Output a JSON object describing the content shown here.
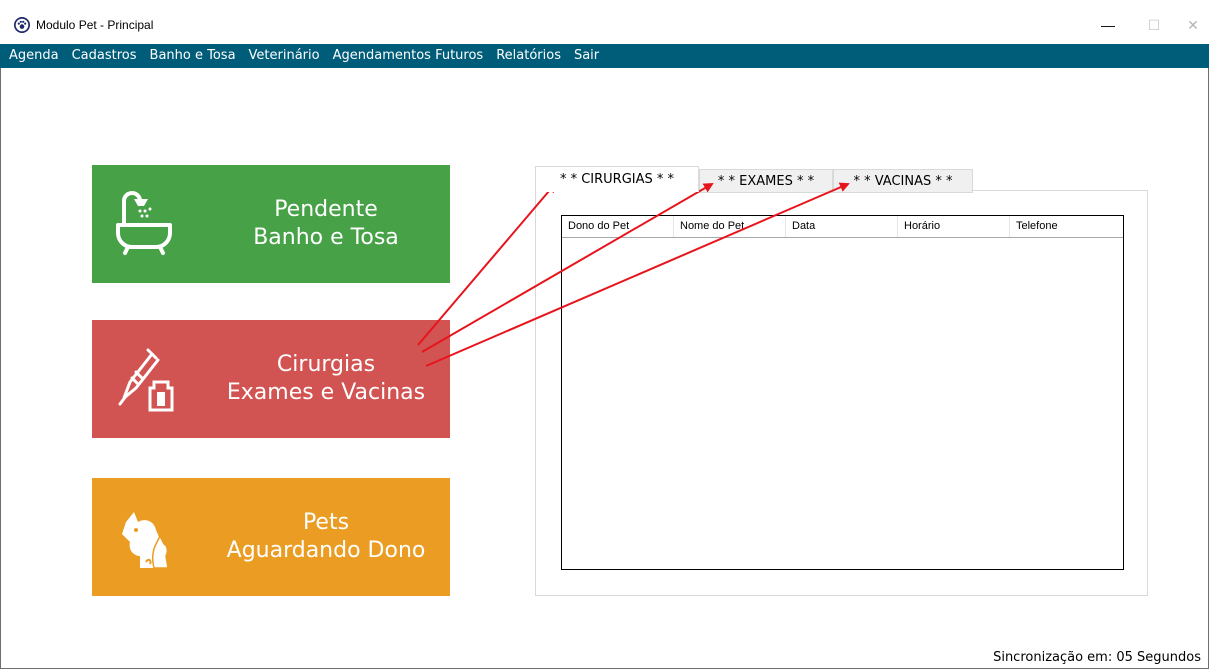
{
  "window": {
    "title": "Modulo Pet - Principal",
    "icon": "paw-icon",
    "controls": {
      "minimize": "—",
      "maximize": "☐",
      "close": "✕"
    }
  },
  "menu": {
    "items": [
      "Agenda",
      "Cadastros",
      "Banho e Tosa",
      "Veterinário",
      "Agendamentos Futuros",
      "Relatórios",
      "Sair"
    ],
    "background": "#005d7a"
  },
  "tiles": [
    {
      "line1": "Pendente",
      "line2": "Banho e Tosa",
      "icon": "bathtub-icon",
      "color": "#47a147"
    },
    {
      "line1": "Cirurgias",
      "line2": "Exames e Vacinas",
      "icon": "syringe-bottle-icon",
      "color": "#d15352"
    },
    {
      "line1": "Pets",
      "line2": "Aguardando Dono",
      "icon": "dog-cat-icon",
      "color": "#eb9c22"
    }
  ],
  "tabs": [
    "* * CIRURGIAS * *",
    "* * EXAMES * *",
    "* * VACINAS * *"
  ],
  "active_tab": "* * CIRURGIAS * *",
  "grid": {
    "columns": [
      "Dono do Pet",
      "Nome do Pet",
      "Data",
      "Horário",
      "Telefone"
    ],
    "rows": []
  },
  "status": "Sincronização em: 05 Segundos",
  "annotation_color": "#e8141c"
}
